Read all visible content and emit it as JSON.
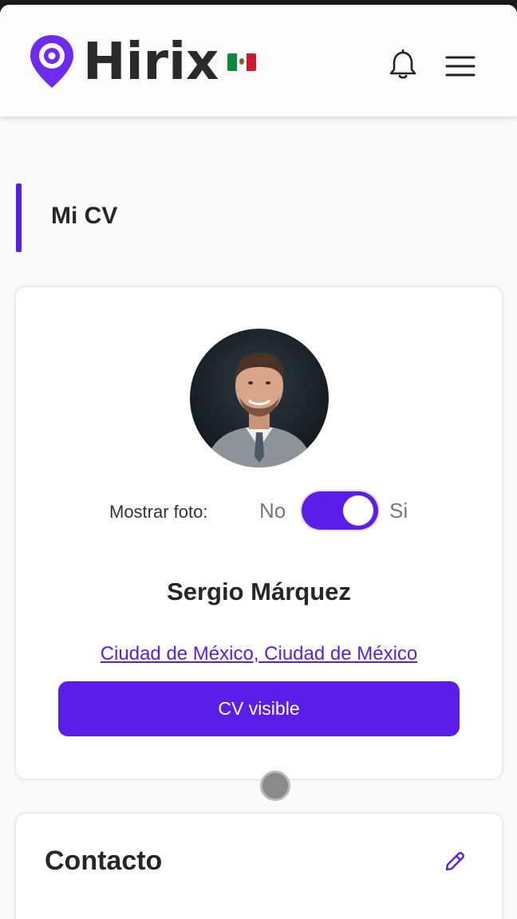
{
  "header": {
    "brand": "Hirix",
    "country_flag": "mexico-flag-icon",
    "notifications_icon": "bell-icon",
    "menu_icon": "hamburger-menu-icon",
    "accent_color": "#5a1ee8"
  },
  "page": {
    "title": "Mi CV"
  },
  "profile": {
    "avatar": "profile-photo",
    "show_photo_label": "Mostrar foto:",
    "toggle_off_label": "No",
    "toggle_on_label": "Si",
    "show_photo_enabled": true,
    "name": "Sergio Márquez",
    "location": "Ciudad de México, Ciudad de México",
    "cv_button_label": "CV visible"
  },
  "contact": {
    "title": "Contacto",
    "edit_icon": "pencil-icon"
  }
}
